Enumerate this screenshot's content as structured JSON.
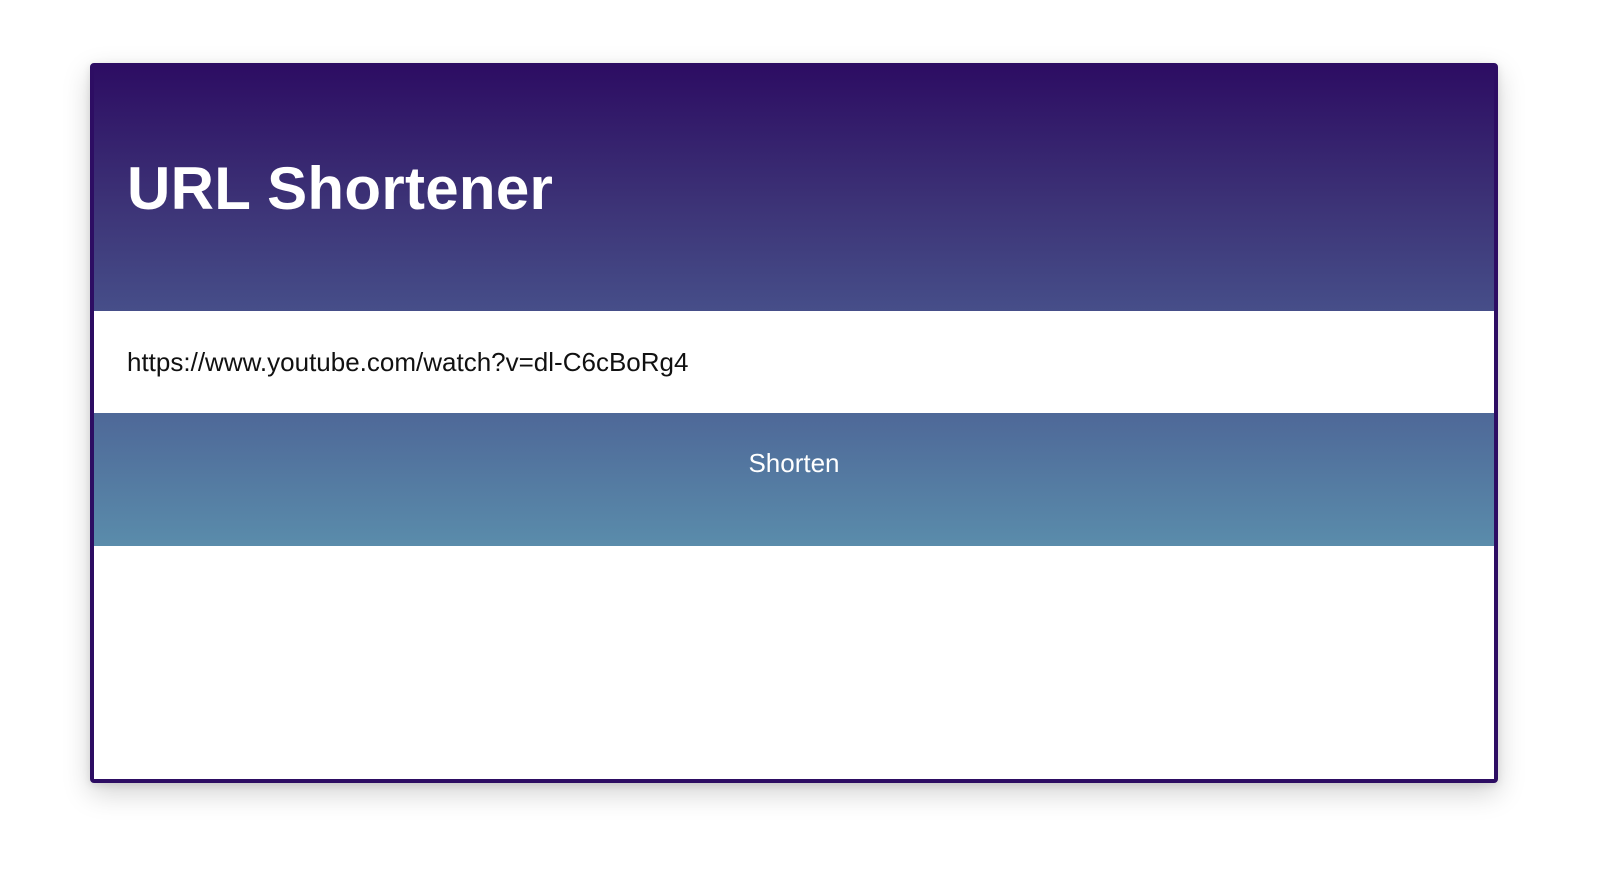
{
  "app": {
    "title": "URL Shortener"
  },
  "form": {
    "url_value": "https://www.youtube.com/watch?v=dl-C6cBoRg4",
    "submit_label": "Shorten"
  },
  "colors": {
    "header_top": "#2d0d63",
    "header_bottom": "#464e89",
    "button_top": "#4e6898",
    "button_bottom": "#5a8cab",
    "border": "#2d0d63"
  }
}
